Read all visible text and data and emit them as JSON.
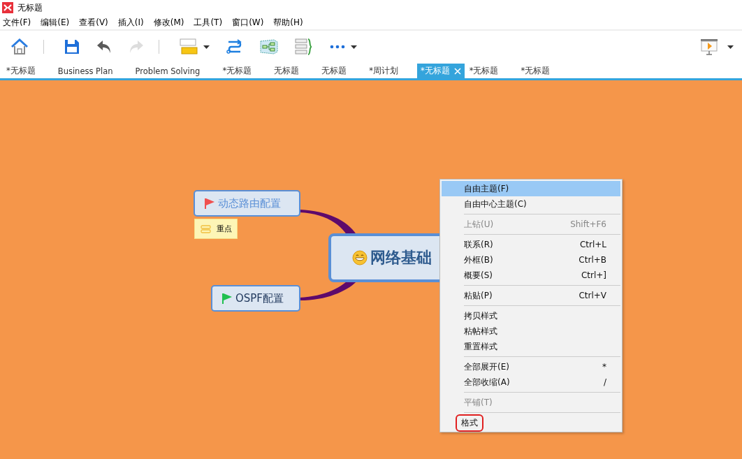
{
  "window": {
    "title": "无标题"
  },
  "menu_bar": [
    "文件(F)",
    "编辑(E)",
    "查看(V)",
    "插入(I)",
    "修改(M)",
    "工具(T)",
    "窗口(W)",
    "帮助(H)"
  ],
  "toolbar": [
    {
      "kind": "home",
      "disabled": false,
      "dropdown": false
    },
    {
      "kind": "sep"
    },
    {
      "kind": "save",
      "disabled": false,
      "dropdown": false
    },
    {
      "kind": "undo",
      "disabled": false,
      "dropdown": false
    },
    {
      "kind": "redo",
      "disabled": true,
      "dropdown": false
    },
    {
      "kind": "sep"
    },
    {
      "kind": "topic",
      "disabled": false,
      "dropdown": true
    },
    {
      "kind": "relationship",
      "disabled": false,
      "dropdown": false
    },
    {
      "kind": "boundary",
      "disabled": false,
      "dropdown": false
    },
    {
      "kind": "summary",
      "disabled": false,
      "dropdown": false
    },
    {
      "kind": "more",
      "disabled": false,
      "dropdown": true
    }
  ],
  "tabs": [
    {
      "label": "*无标题",
      "selected": false
    },
    {
      "label": "Business Plan",
      "selected": false
    },
    {
      "label": "Problem Solving",
      "selected": false
    },
    {
      "label": "*无标题",
      "selected": false
    },
    {
      "label": "无标题",
      "selected": false
    },
    {
      "label": "无标题",
      "selected": false
    },
    {
      "label": "*周计划",
      "selected": false
    },
    {
      "label": "*无标题",
      "selected": true
    },
    {
      "label": "*无标题",
      "selected": false
    },
    {
      "label": "*无标题",
      "selected": false
    }
  ],
  "mind_map": {
    "central": {
      "label": "网络基础"
    },
    "topics": [
      {
        "label": "动态路由配置",
        "color": "#f05050",
        "label_tag": "重点"
      },
      {
        "label": "OSPF配置",
        "color": "#20c050"
      }
    ]
  },
  "context_menu": [
    [
      {
        "label": "自由主题(F)",
        "selected": true,
        "disabled": false
      },
      {
        "label": "自由中心主题(C)",
        "selected": false,
        "disabled": false
      }
    ],
    [
      {
        "label": "上钻(U)",
        "shortcut": "Shift+F6",
        "selected": false,
        "disabled": true
      }
    ],
    [
      {
        "label": "联系(R)",
        "shortcut": "Ctrl+L",
        "selected": false,
        "disabled": false
      },
      {
        "label": "外框(B)",
        "shortcut": "Ctrl+B",
        "selected": false,
        "disabled": false
      },
      {
        "label": "概要(S)",
        "shortcut": "Ctrl+]",
        "selected": false,
        "disabled": false
      }
    ],
    [
      {
        "label": "粘贴(P)",
        "shortcut": "Ctrl+V",
        "selected": false,
        "disabled": false
      }
    ],
    [
      {
        "label": "拷贝样式",
        "selected": false,
        "disabled": false
      },
      {
        "label": "粘帖样式",
        "selected": false,
        "disabled": false
      },
      {
        "label": "重置样式",
        "selected": false,
        "disabled": false
      }
    ],
    [
      {
        "label": "全部展开(E)",
        "shortcut": "*",
        "selected": false,
        "disabled": false
      },
      {
        "label": "全部收缩(A)",
        "shortcut": "/",
        "selected": false,
        "disabled": false
      }
    ],
    [
      {
        "label": "平铺(T)",
        "selected": false,
        "disabled": true
      }
    ],
    [
      {
        "label": "格式",
        "selected": false,
        "disabled": false,
        "annotated": true
      }
    ]
  ]
}
